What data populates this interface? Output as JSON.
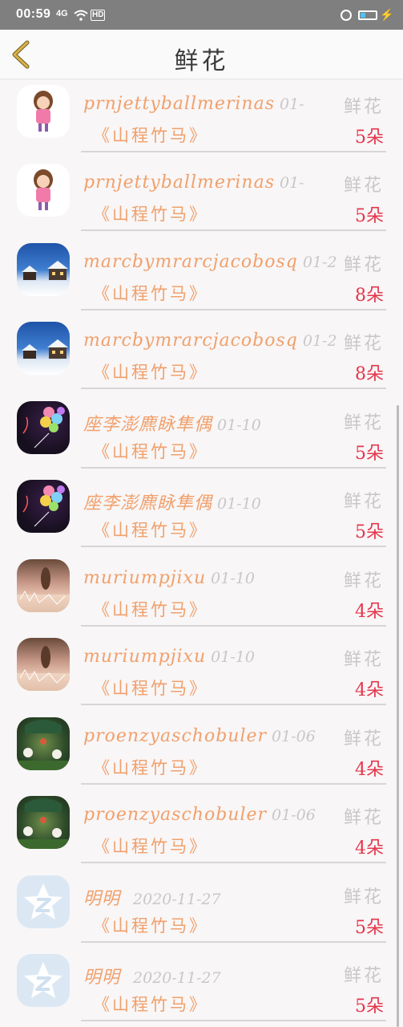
{
  "status_bar": {
    "time": "00:59",
    "signal": "4G",
    "network_badge": "HD"
  },
  "header": {
    "title": "鲜花"
  },
  "gift_label": "鲜花",
  "rows": [
    {
      "name": "prnjettyballmerinas",
      "date": "01-",
      "story": "《山程竹马》",
      "count": "5朵",
      "avatar": "girl-avatar"
    },
    {
      "name": "prnjettyballmerinas",
      "date": "01-",
      "story": "《山程竹马》",
      "count": "5朵",
      "avatar": "girl-avatar"
    },
    {
      "name": "marcbymrarcjacobosq",
      "date": "01-2",
      "story": "《山程竹马》",
      "count": "8朵",
      "avatar": "snow-house-avatar"
    },
    {
      "name": "marcbymrarcjacobosq",
      "date": "01-2",
      "story": "《山程竹马》",
      "count": "8朵",
      "avatar": "snow-house-avatar"
    },
    {
      "name": "座李澎麃眿隼偶",
      "date": "01-10",
      "story": "《山程竹马》",
      "count": "5朵",
      "avatar": "balloon-avatar"
    },
    {
      "name": "座李澎麃眿隼偶",
      "date": "01-10",
      "story": "《山程竹马》",
      "count": "5朵",
      "avatar": "balloon-avatar"
    },
    {
      "name": "muriumpjixu",
      "date": "01-10",
      "story": "《山程竹马》",
      "count": "4朵",
      "avatar": "field-avatar"
    },
    {
      "name": "muriumpjixu",
      "date": "01-10",
      "story": "《山程竹马》",
      "count": "4朵",
      "avatar": "field-avatar"
    },
    {
      "name": "proenzyaschobuler",
      "date": "01-06",
      "story": "《山程竹马》",
      "count": "4朵",
      "avatar": "garden-avatar"
    },
    {
      "name": "proenzyaschobuler",
      "date": "01-06",
      "story": "《山程竹马》",
      "count": "4朵",
      "avatar": "garden-avatar"
    },
    {
      "name": "明明",
      "date": "2020-11-27",
      "story": "《山程竹马》",
      "count": "5朵",
      "avatar": "qq-avatar"
    },
    {
      "name": "明明",
      "date": "2020-11-27",
      "story": "《山程竹马》",
      "count": "5朵",
      "avatar": "qq-avatar"
    }
  ],
  "colors": {
    "accent_name": "#f1a06b",
    "count": "#e5364b",
    "muted": "#c9c7c8",
    "back_arrow": "#d8b24a"
  }
}
